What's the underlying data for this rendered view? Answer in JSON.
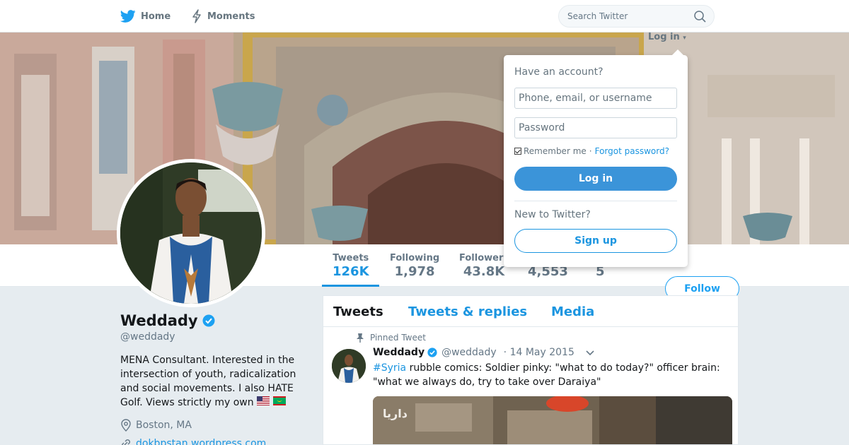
{
  "nav": {
    "home_label": "Home",
    "moments_label": "Moments",
    "search_placeholder": "Search Twitter",
    "login_label": "Log in"
  },
  "stats": [
    {
      "label": "Tweets",
      "value": "126K"
    },
    {
      "label": "Following",
      "value": "1,978"
    },
    {
      "label": "Followers",
      "value": "43.8K"
    },
    {
      "label": "",
      "value": "4,553"
    },
    {
      "label": "",
      "value": "5"
    }
  ],
  "follow_label": "Follow",
  "profile": {
    "name": "Weddady",
    "handle": "@weddady",
    "bio": "MENA Consultant. Interested in the intersection of youth, radicalization and social movements. I also HATE Golf. Views strictly my own",
    "location": "Boston, MA",
    "url": "dokbpstan.wordpress.com"
  },
  "tabs": {
    "tweets": "Tweets",
    "replies": "Tweets & replies",
    "media": "Media"
  },
  "tweet": {
    "pinned_label": "Pinned Tweet",
    "name": "Weddady",
    "handle": "@weddady",
    "date": "· 14 May 2015",
    "hashtag": "#Syria",
    "text": " rubble comics: Soldier pinky: \"what to do today?\" officer brain: \"what we always do, try to take over Daraiya\"",
    "media_overlay_text": "داريا"
  },
  "login_dropdown": {
    "have_account": "Have an account?",
    "username_placeholder": "Phone, email, or username",
    "password_placeholder": "Password",
    "remember_me": "Remember me",
    "separator": "·",
    "forgot_password": "Forgot password?",
    "login_button": "Log in",
    "new_to_twitter": "New to Twitter?",
    "signup_button": "Sign up"
  },
  "colors": {
    "accent": "#1b95e0",
    "login_button": "#3b94d9",
    "background": "#e6ecf0",
    "verified": "#1da1f2"
  }
}
